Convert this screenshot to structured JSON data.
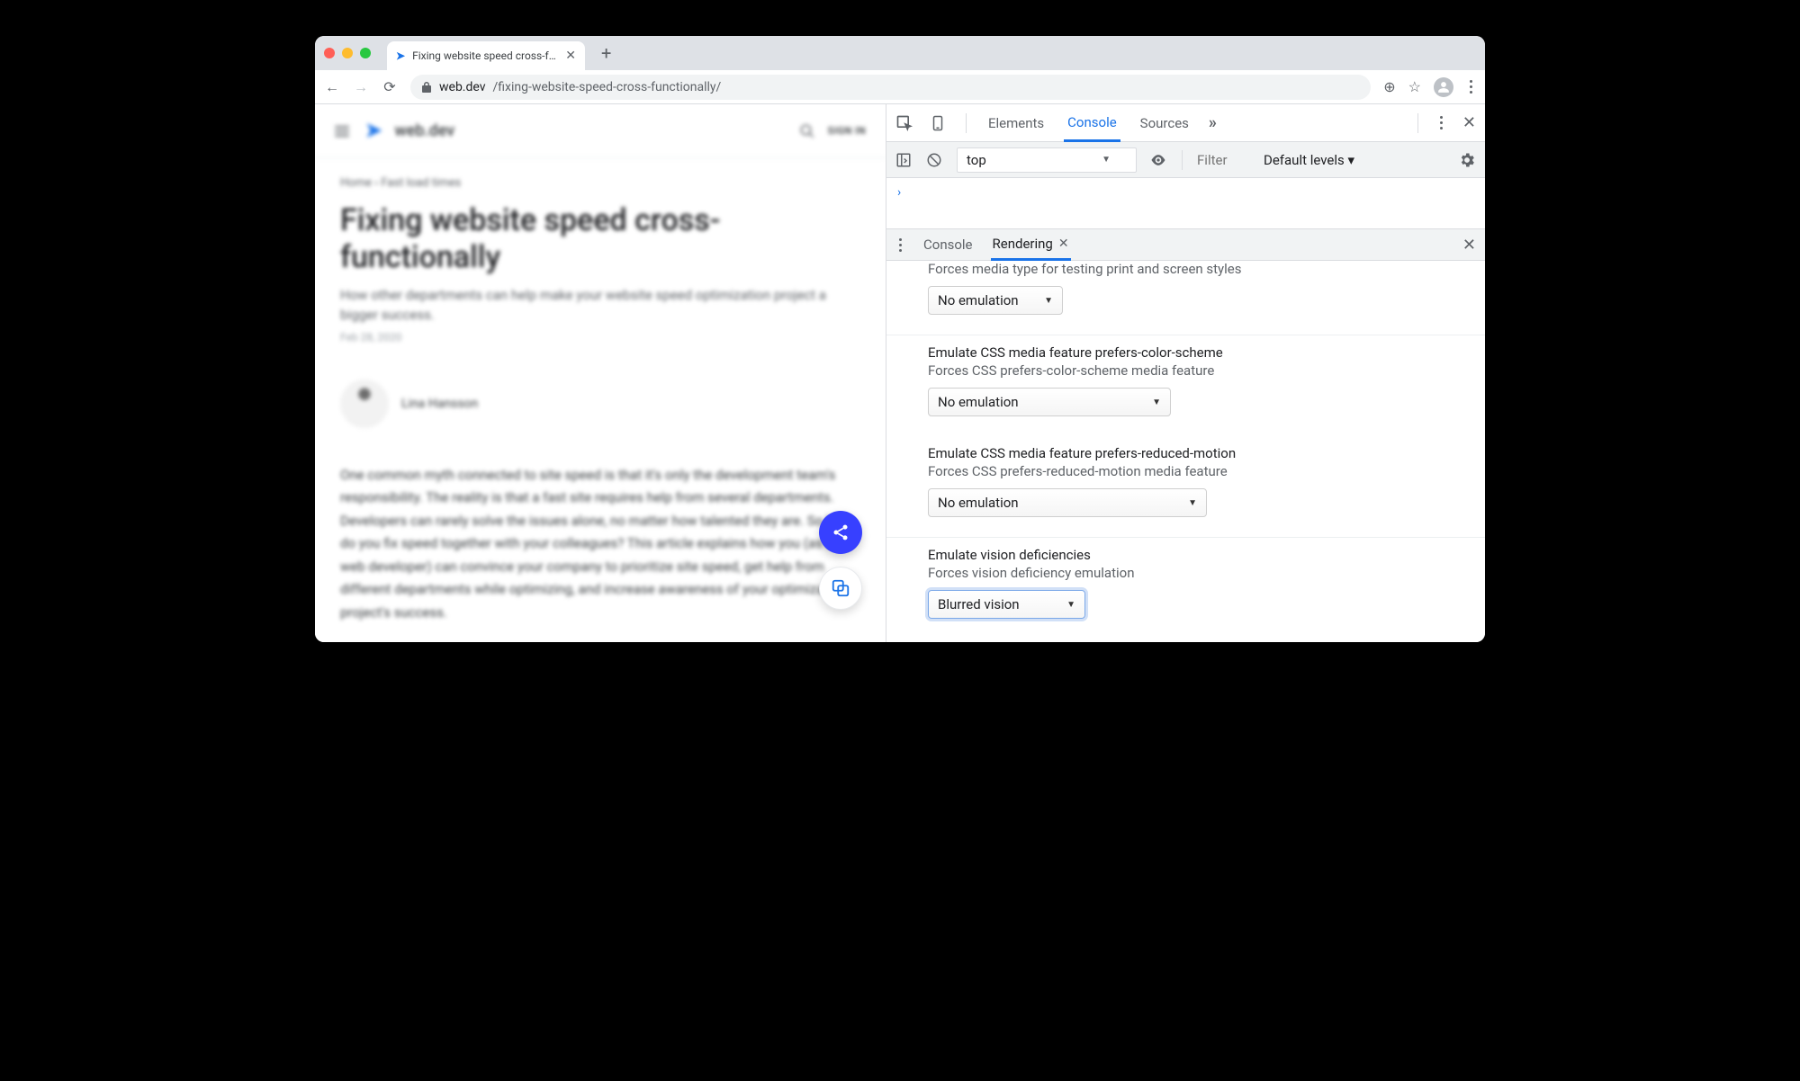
{
  "browser": {
    "tab_title": "Fixing website speed cross-fun",
    "url_domain": "web.dev",
    "url_path": "/fixing-website-speed-cross-functionally/"
  },
  "page": {
    "brand": "web.dev",
    "signin": "SIGN IN",
    "breadcrumb": "Home   ›   Fast load times",
    "title": "Fixing website speed cross-functionally",
    "subtitle": "How other departments can help make your website speed optimization project a bigger success.",
    "date": "Feb 28, 2020",
    "author": "Lina Hansson",
    "body": "One common myth connected to site speed is that it's only the development team's responsibility. The reality is that a fast site requires help from several departments. Developers can rarely solve the issues alone, no matter how talented they are. So how do you fix speed together with your colleagues? This article explains how you (as a web developer) can convince your company to prioritize site speed, get help from different departments while optimizing, and increase awareness of your optimization project's success."
  },
  "devtools": {
    "tabs": {
      "elements": "Elements",
      "console": "Console",
      "sources": "Sources"
    },
    "console_bar": {
      "context": "top",
      "filter_placeholder": "Filter",
      "levels": "Default levels ▾"
    },
    "console_prompt": "›",
    "drawer": {
      "tab_console": "Console",
      "tab_rendering": "Rendering"
    },
    "rendering": {
      "media_desc": "Forces media type for testing print and screen styles",
      "media_value": "No emulation",
      "color_title": "Emulate CSS media feature prefers-color-scheme",
      "color_desc": "Forces CSS prefers-color-scheme media feature",
      "color_value": "No emulation",
      "motion_title": "Emulate CSS media feature prefers-reduced-motion",
      "motion_desc": "Forces CSS prefers-reduced-motion media feature",
      "motion_value": "No emulation",
      "vision_title": "Emulate vision deficiencies",
      "vision_desc": "Forces vision deficiency emulation",
      "vision_value": "Blurred vision"
    }
  }
}
